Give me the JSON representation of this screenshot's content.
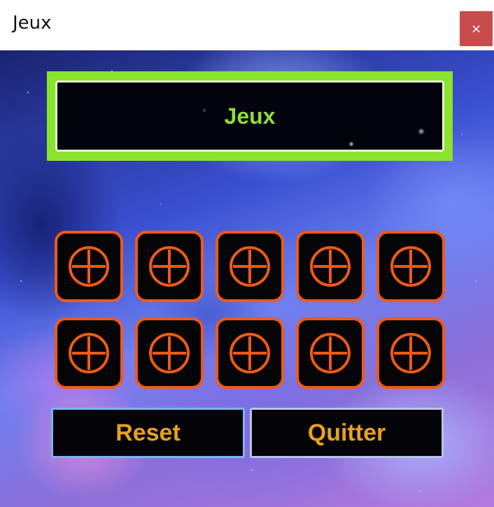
{
  "window": {
    "title": "Jeux",
    "close_label": "×"
  },
  "header": {
    "title": "Jeux"
  },
  "grid": {
    "rows": 2,
    "columns": 5,
    "cell_icon": "circled-plus-icon"
  },
  "buttons": {
    "reset_label": "Reset",
    "quit_label": "Quitter"
  },
  "colors": {
    "header_frame": "#8ae32c",
    "header_text": "#8fdc3a",
    "cell_border": "#f05a16",
    "button_text": "#e8a11a",
    "close_button": "#c94c4c"
  }
}
